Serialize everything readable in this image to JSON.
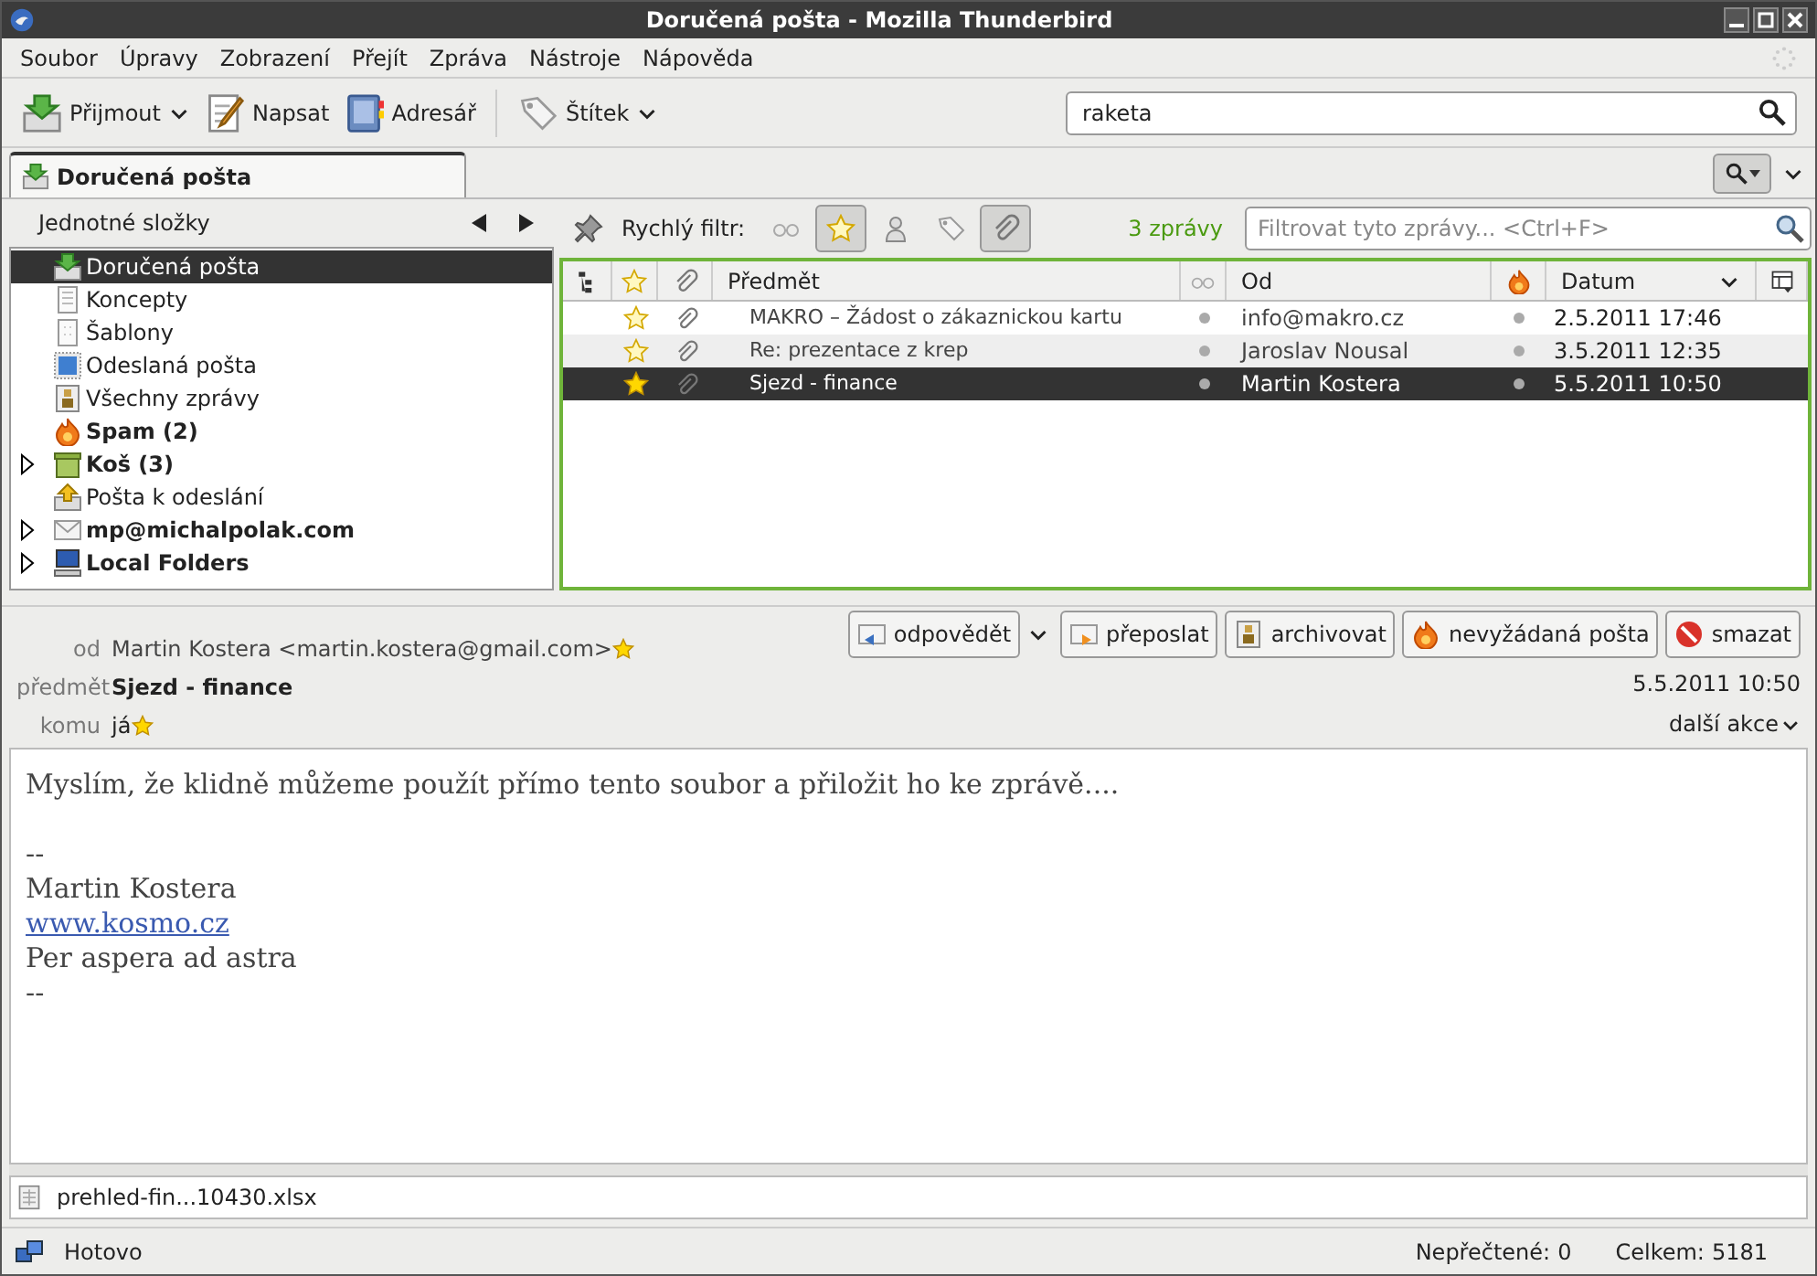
{
  "window": {
    "title": "Doručená pošta - Mozilla Thunderbird"
  },
  "menu": [
    "Soubor",
    "Úpravy",
    "Zobrazení",
    "Přejít",
    "Zpráva",
    "Nástroje",
    "Nápověda"
  ],
  "toolbar": [
    {
      "label": "Přijmout",
      "kind": "get",
      "dropdown": true
    },
    {
      "label": "Napsat",
      "kind": "write",
      "dropdown": false
    },
    {
      "label": "Adresář",
      "kind": "book",
      "dropdown": false
    },
    {
      "label": "Štítek",
      "kind": "tag",
      "dropdown": true
    }
  ],
  "search": {
    "value": "raketa"
  },
  "tabs": [
    {
      "label": "Doručená pošta",
      "selected": true
    }
  ],
  "folder_pane": {
    "title": "Jednotné složky",
    "folders": [
      {
        "label": "Doručená pošta",
        "kind": "inbox",
        "selected": true,
        "bold": false,
        "expandable": false
      },
      {
        "label": "Koncepty",
        "kind": "drafts",
        "selected": false,
        "bold": false,
        "expandable": false
      },
      {
        "label": "Šablony",
        "kind": "templates",
        "selected": false,
        "bold": false,
        "expandable": false
      },
      {
        "label": "Odeslaná pošta",
        "kind": "sent",
        "selected": false,
        "bold": false,
        "expandable": false
      },
      {
        "label": "Všechny zprávy",
        "kind": "archive",
        "selected": false,
        "bold": false,
        "expandable": false
      },
      {
        "label": "Spam (2)",
        "kind": "spam",
        "selected": false,
        "bold": true,
        "expandable": false
      },
      {
        "label": "Koš (3)",
        "kind": "trash",
        "selected": false,
        "bold": true,
        "expandable": true
      },
      {
        "label": "Pošta k odeslání",
        "kind": "outbox",
        "selected": false,
        "bold": false,
        "expandable": false
      },
      {
        "label": "mp@michalpolak.com",
        "kind": "account",
        "selected": false,
        "bold": true,
        "expandable": true
      },
      {
        "label": "Local Folders",
        "kind": "local",
        "selected": false,
        "bold": true,
        "expandable": true
      }
    ]
  },
  "quick_filter": {
    "label": "Rychlý filtr:",
    "buttons": [
      {
        "kind": "unread",
        "selected": false
      },
      {
        "kind": "starred",
        "selected": true
      },
      {
        "kind": "contact",
        "selected": false
      },
      {
        "kind": "tags",
        "selected": false
      },
      {
        "kind": "attachment",
        "selected": true
      }
    ],
    "count": "3 zprávy",
    "placeholder": "Filtrovat tyto zprávy... <Ctrl+F>"
  },
  "thread_list": {
    "columns": [
      {
        "kind": "thread"
      },
      {
        "kind": "star"
      },
      {
        "kind": "attachment"
      },
      {
        "kind": "text",
        "label": "Předmět",
        "sorted": false
      },
      {
        "kind": "read"
      },
      {
        "kind": "text",
        "label": "Od",
        "sorted": false
      },
      {
        "kind": "junk"
      },
      {
        "kind": "text",
        "label": "Datum",
        "sorted": true
      },
      {
        "kind": "picker"
      }
    ],
    "rows": [
      {
        "starred": false,
        "attachment": true,
        "subject": "MAKRO – Žádost o zákaznickou kartu",
        "from": "info@makro.cz",
        "date": "2.5.2011 17:46",
        "selected": false
      },
      {
        "starred": false,
        "attachment": true,
        "subject": "Re: prezentace z krep",
        "from": "Jaroslav Nousal",
        "date": "3.5.2011 12:35",
        "selected": false
      },
      {
        "starred": true,
        "attachment": true,
        "subject": "Sjezd - finance",
        "from": "Martin Kostera",
        "date": "5.5.2011 10:50",
        "selected": true
      }
    ]
  },
  "message": {
    "fields": [
      {
        "label": "od",
        "value": "Martin Kostera <martin.kostera@gmail.com>",
        "starred": true,
        "bold": false
      },
      {
        "label": "předmět",
        "value": "Sjezd - finance",
        "starred": false,
        "bold": true
      },
      {
        "label": "komu",
        "value": "já",
        "starred": true,
        "bold": false
      }
    ],
    "buttons": [
      {
        "label": "odpovědět",
        "kind": "reply",
        "dropdown": true
      },
      {
        "label": "přeposlat",
        "kind": "forward",
        "dropdown": false
      },
      {
        "label": "archivovat",
        "kind": "archive",
        "dropdown": false
      },
      {
        "label": "nevyžádaná pošta",
        "kind": "junk",
        "dropdown": false
      },
      {
        "label": "smazat",
        "kind": "delete",
        "dropdown": false
      }
    ],
    "date": "5.5.2011 10:50",
    "more_actions": "další akce",
    "body": [
      {
        "kind": "text",
        "text": "Myslím, že klidně můžeme použít přímo tento soubor a přiložit ho ke zprávě...."
      },
      {
        "kind": "gap"
      },
      {
        "kind": "text",
        "text": "--"
      },
      {
        "kind": "text",
        "text": "Martin Kostera"
      },
      {
        "kind": "link",
        "text": "www.kosmo.cz"
      },
      {
        "kind": "text",
        "text": "Per aspera ad astra"
      },
      {
        "kind": "text",
        "text": "--"
      }
    ],
    "attachments": [
      "prehled-fin...10430.xlsx"
    ]
  },
  "status_bar": {
    "text": "Hotovo",
    "unread_label": "Nepřečtené:",
    "unread": "0",
    "total_label": "Celkem:",
    "total": "5181"
  }
}
